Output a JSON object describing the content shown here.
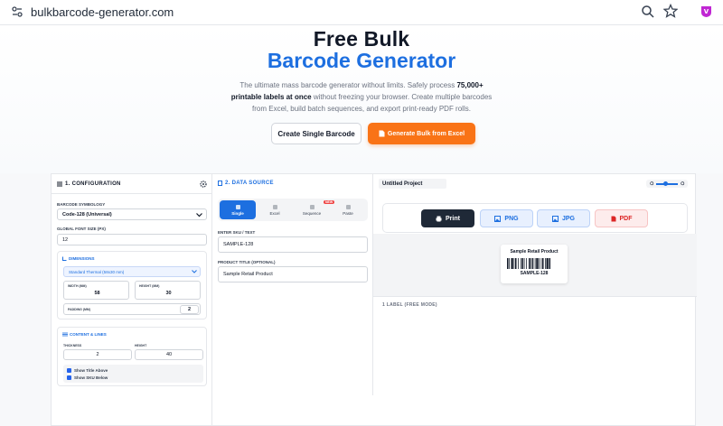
{
  "browser": {
    "url": "bulkbarcode-generator.com"
  },
  "hero": {
    "title_line1": "Free Bulk",
    "title_line2": "Barcode Generator",
    "desc_a": "The ultimate mass barcode generator without limits. Safely process ",
    "desc_b": "75,000+ printable labels at once",
    "desc_c": " without freezing your browser. Create multiple barcodes from Excel, build batch sequences, and export print-ready PDF rolls.",
    "btn_single": "Create Single Barcode",
    "btn_bulk": "Generate Bulk from Excel"
  },
  "config": {
    "title": "1. CONFIGURATION",
    "symbology_label": "BARCODE SYMBOLOGY",
    "symbology_value": "Code-128 (Universal)",
    "font_size_label": "GLOBAL FONT SIZE (PX)",
    "font_size_value": "12",
    "dimensions": {
      "title": "DIMENSIONS",
      "preset": "Standard Thermal (58x30 mm)",
      "width_label": "WIDTH (MM)",
      "width_value": "58",
      "height_label": "HEIGHT (MM)",
      "height_value": "30",
      "padding_label": "PADDING (MM)",
      "padding_value": "2"
    },
    "content": {
      "title": "CONTENT & LINES",
      "thickness_label": "THICKNESS",
      "thickness_value": "2",
      "height_label": "HEIGHT",
      "height_value": "40",
      "show_title": "Show Title Above",
      "show_sku": "Show SKU Below"
    }
  },
  "data_source": {
    "title": "2. DATA SOURCE",
    "tabs": [
      {
        "label": "Single"
      },
      {
        "label": "Excel"
      },
      {
        "label": "Sequence"
      },
      {
        "label": "Paste"
      }
    ],
    "new_badge": "NEW",
    "sku_label": "ENTER SKU / TEXT",
    "sku_value": "SAMPLE-128",
    "product_label": "PRODUCT TITLE (OPTIONAL)",
    "product_value": "Sample Retail Product"
  },
  "preview": {
    "project_name": "Untitled Project",
    "buttons": {
      "print": "Print",
      "png": "PNG",
      "jpg": "JPG",
      "pdf": "PDF"
    },
    "label_title": "Sample Retail Product",
    "label_sku": "SAMPLE-128",
    "labels_count": "1 LABEL (FREE MODE)"
  },
  "colors": {
    "accent_blue": "#1d6fe0",
    "accent_orange": "#f97316",
    "pdf_red": "#dc2626",
    "print_dark": "#1f2937"
  },
  "icons": [
    "site-settings-icon",
    "zoom-icon",
    "star-icon",
    "extension-icon",
    "menu-icon",
    "gear-icon",
    "chevron-down-icon",
    "ruler-icon",
    "lines-icon",
    "printer-icon",
    "image-icon",
    "file-icon",
    "file-excel-icon"
  ]
}
